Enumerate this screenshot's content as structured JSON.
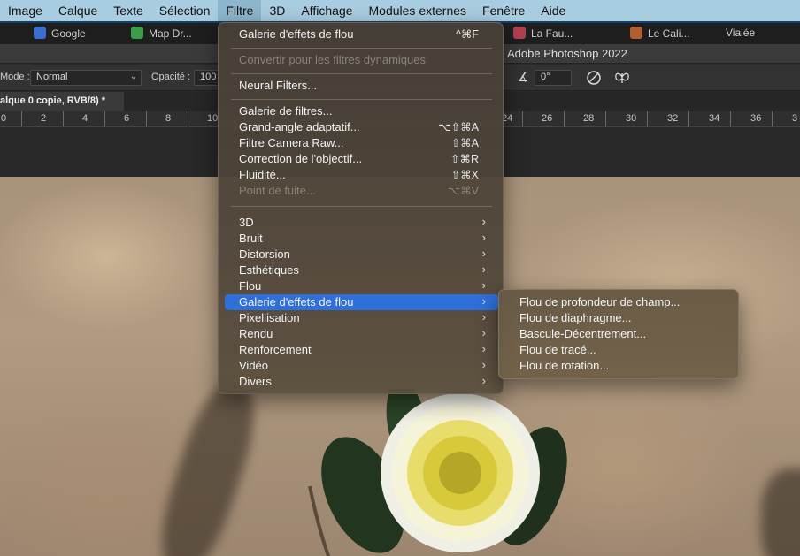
{
  "menubar": {
    "items": [
      "Image",
      "Calque",
      "Texte",
      "Sélection",
      "Filtre",
      "3D",
      "Affichage",
      "Modules externes",
      "Fenêtre",
      "Aide"
    ],
    "active_index": 4
  },
  "tabstrip": {
    "fragments": [
      "Google",
      "Map Dr...",
      "La Fau...",
      "Le Cali...",
      "Vialée"
    ]
  },
  "app": {
    "title": "Adobe Photoshop 2022"
  },
  "options": {
    "mode_label": "Mode :",
    "mode_value": "Normal",
    "opacity_label": "Opacité :",
    "opacity_value": "100",
    "angle_value": "0°"
  },
  "document": {
    "tab_title": "alque 0 copie, RVB/8) *"
  },
  "ruler": {
    "ticks": [
      "0",
      "2",
      "4",
      "6",
      "8",
      "10",
      "24",
      "26",
      "28",
      "30",
      "32",
      "34",
      "36",
      "3"
    ]
  },
  "filter_menu": {
    "items": [
      {
        "label": "Galerie d'effets de flou",
        "shortcut": "^⌘F"
      },
      {
        "label": "Convertir pour les filtres dynamiques",
        "disabled": true
      },
      {
        "label": "Neural Filters..."
      },
      {
        "label": "Galerie de filtres..."
      },
      {
        "label": "Grand-angle adaptatif...",
        "shortcut": "⌥⇧⌘A"
      },
      {
        "label": "Filtre Camera Raw...",
        "shortcut": "⇧⌘A"
      },
      {
        "label": "Correction de l'objectif...",
        "shortcut": "⇧⌘R"
      },
      {
        "label": "Fluidité...",
        "shortcut": "⇧⌘X"
      },
      {
        "label": "Point de fuite...",
        "shortcut": "⌥⌘V",
        "disabled": true
      },
      {
        "label": "3D",
        "submenu": true
      },
      {
        "label": "Bruit",
        "submenu": true
      },
      {
        "label": "Distorsion",
        "submenu": true
      },
      {
        "label": "Esthétiques",
        "submenu": true
      },
      {
        "label": "Flou",
        "submenu": true
      },
      {
        "label": "Galerie d'effets de flou",
        "submenu": true,
        "highlighted": true
      },
      {
        "label": "Pixellisation",
        "submenu": true
      },
      {
        "label": "Rendu",
        "submenu": true
      },
      {
        "label": "Renforcement",
        "submenu": true
      },
      {
        "label": "Vidéo",
        "submenu": true
      },
      {
        "label": "Divers",
        "submenu": true
      }
    ]
  },
  "blur_gallery_submenu": {
    "items": [
      "Flou de profondeur de champ...",
      "Flou de diaphragme...",
      "Bascule-Décentrement...",
      "Flou de tracé...",
      "Flou de rotation..."
    ]
  },
  "colors": {
    "highlight": "#2f6fd8",
    "menubar": "#a9cde0"
  }
}
